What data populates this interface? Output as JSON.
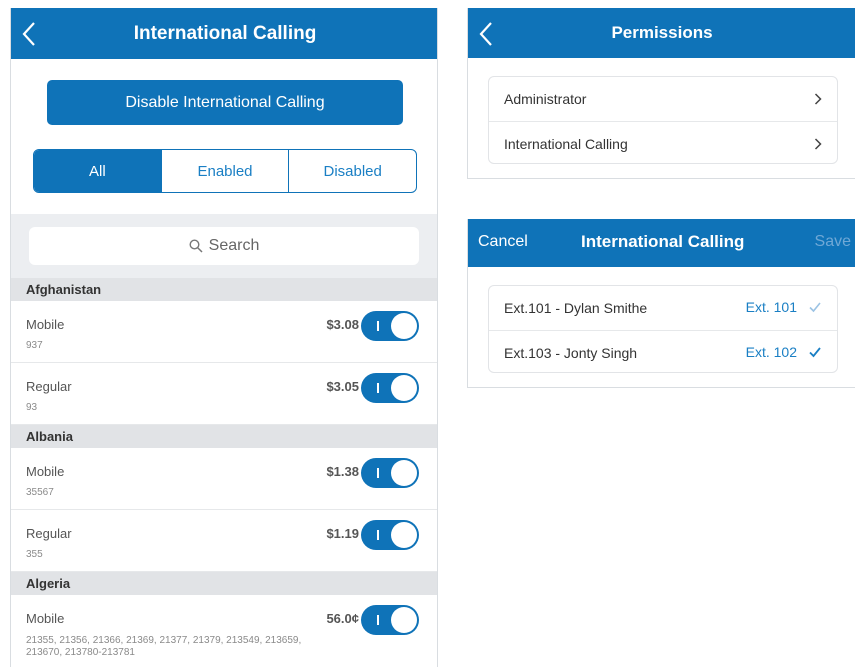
{
  "left": {
    "title": "International Calling",
    "primary_button": "Disable International Calling",
    "filters": [
      "All",
      "Enabled",
      "Disabled"
    ],
    "active_filter": "All",
    "search_placeholder": "Search",
    "sections": [
      {
        "country": "Afghanistan",
        "items": [
          {
            "name": "Mobile",
            "code": "937",
            "price": "$3.08",
            "enabled": true
          },
          {
            "name": "Regular",
            "code": "93",
            "price": "$3.05",
            "enabled": true
          }
        ]
      },
      {
        "country": "Albania",
        "items": [
          {
            "name": "Mobile",
            "code": "35567",
            "price": "$1.38",
            "enabled": true
          },
          {
            "name": "Regular",
            "code": "355",
            "price": "$1.19",
            "enabled": true
          }
        ]
      },
      {
        "country": "Algeria",
        "items": [
          {
            "name": "Mobile",
            "code": "21355, 21356, 21366, 21369, 21377, 21379, 213549, 213659, 213670, 213780-213781",
            "price": "56.0¢",
            "enabled": true
          }
        ]
      }
    ]
  },
  "permissions": {
    "title": "Permissions",
    "rows": [
      "Administrator",
      "International Calling"
    ]
  },
  "intl_edit": {
    "cancel": "Cancel",
    "title": "International Calling",
    "save": "Save",
    "rows": [
      {
        "name": "Ext.101 - Dylan Smithe",
        "ext": "Ext. 101",
        "checked": true,
        "check_faded": true
      },
      {
        "name": "Ext.103 - Jonty Singh",
        "ext": "Ext. 102",
        "checked": true,
        "check_faded": false
      }
    ]
  },
  "colors": {
    "accent": "#0f73b8",
    "link": "#1a7fc4",
    "section_bg": "#e1e3e6",
    "search_bg": "#eceef1"
  },
  "icons": {
    "back": "chevron-left-icon",
    "search": "search-icon",
    "row": "chevron-right-icon",
    "check": "checkmark-icon"
  }
}
